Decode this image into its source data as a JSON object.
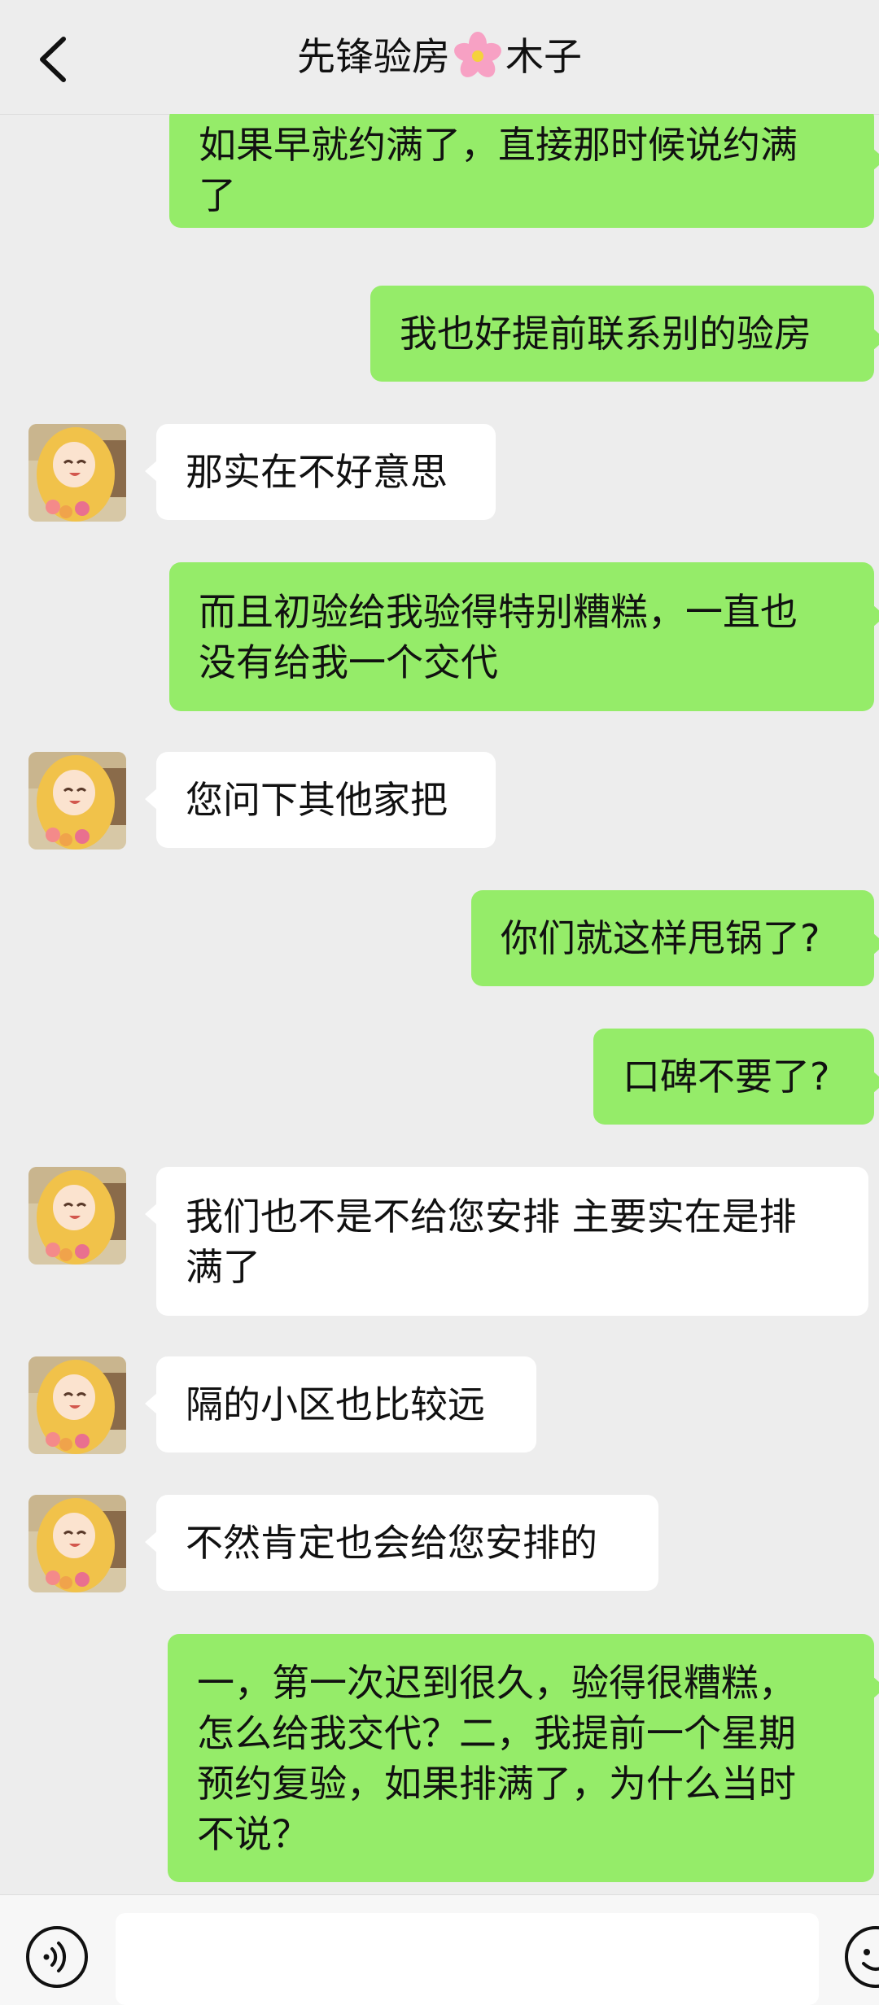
{
  "header": {
    "title_prefix": "先锋验房",
    "title_suffix": "木子",
    "back_icon": "chevron-left-icon",
    "flower_icon": "cherry-blossom-icon"
  },
  "colors": {
    "background": "#ededed",
    "my_bubble": "#95ec69",
    "their_bubble": "#ffffff"
  },
  "messages": [
    {
      "from": "me",
      "text": "如果早就约满了，直接那时候说约满\n了"
    },
    {
      "from": "me",
      "text": "我也好提前联系别的验房"
    },
    {
      "from": "them",
      "text": "那实在不好意思"
    },
    {
      "from": "me",
      "text": "而且初验给我验得特别糟糕，一直也\n没有给我一个交代"
    },
    {
      "from": "them",
      "text": "您问下其他家把"
    },
    {
      "from": "me",
      "text": "你们就这样甩锅了?"
    },
    {
      "from": "me",
      "text": "口碑不要了?"
    },
    {
      "from": "them",
      "text": "我们也不是不给您安排 主要实在是排\n满了"
    },
    {
      "from": "them",
      "text": "隔的小区也比较远"
    },
    {
      "from": "them",
      "text": "不然肯定也会给您安排的"
    },
    {
      "from": "me",
      "text": "一，第一次迟到很久，验得很糟糕，\n怎么给我交代？二，我提前一个星期\n预约复验，如果排满了，为什么当时\n不说？"
    }
  ],
  "input": {
    "voice_icon": "voice-icon",
    "emoji_icon": "emoji-icon",
    "placeholder": ""
  }
}
